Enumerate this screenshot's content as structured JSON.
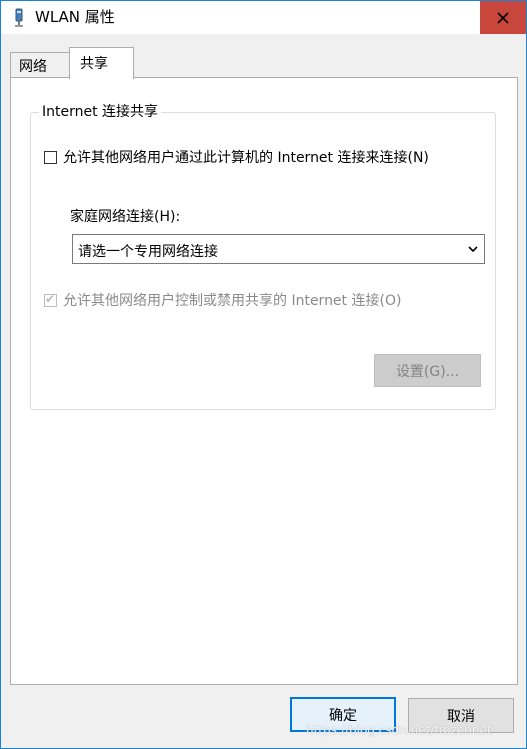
{
  "window": {
    "title": "WLAN 属性",
    "close_icon": "close-icon",
    "app_icon": "network-adapter-icon"
  },
  "tabs": [
    {
      "label": "网络",
      "selected": false
    },
    {
      "label": "共享",
      "selected": true
    }
  ],
  "sharing": {
    "group_title": "Internet 连接共享",
    "allow_connect_label": "允许其他网络用户通过此计算机的 Internet 连接来连接(N)",
    "allow_connect_checked": false,
    "home_network_label": "家庭网络连接(H):",
    "home_network_select_value": "请选一个专用网络连接",
    "allow_control_label": "允许其他网络用户控制或禁用共享的 Internet 连接(O)",
    "allow_control_checked": true,
    "allow_control_enabled": false,
    "settings_button": "设置(G)..."
  },
  "footer": {
    "ok_label": "确定",
    "cancel_label": "取消"
  },
  "watermark": "https://blog.csdn.net/frozennet",
  "colors": {
    "close_button": "#c9463d",
    "window_border": "#1883d7",
    "default_button_border": "#0078d7",
    "disabled_text": "#8a8a8a"
  }
}
